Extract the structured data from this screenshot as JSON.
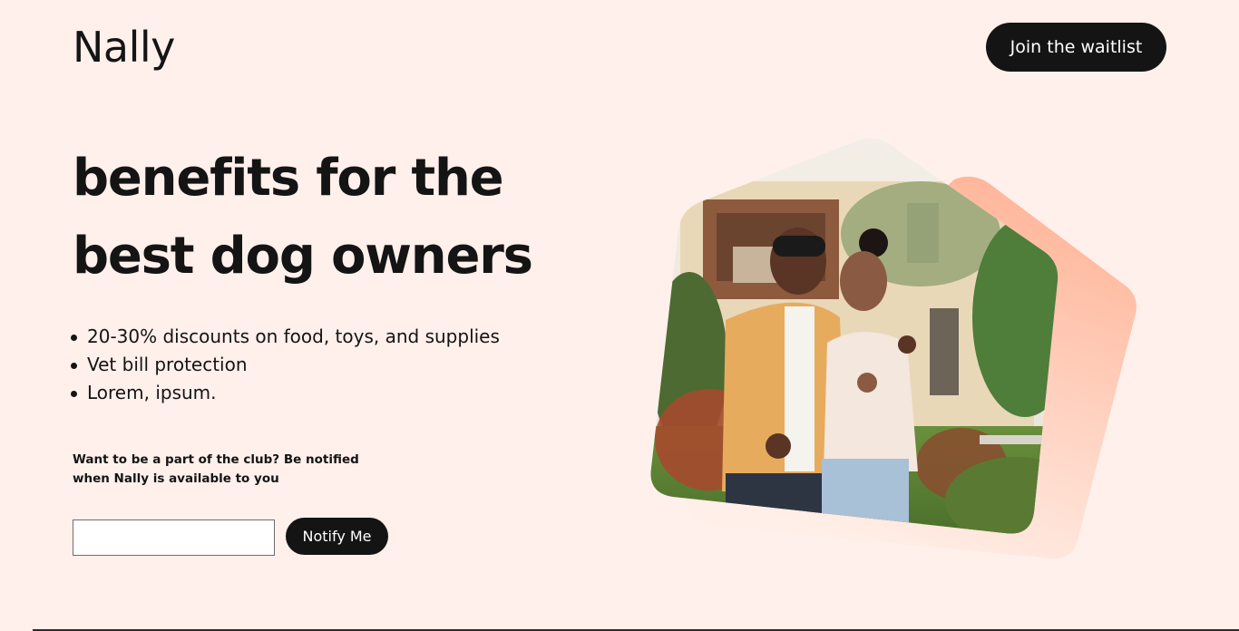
{
  "brand": {
    "name": "Nally"
  },
  "header": {
    "waitlist_button": "Join the waitlist"
  },
  "hero": {
    "headline_line1": "benefits for the",
    "headline_line2": "best dog owners",
    "benefits": [
      "20-30% discounts on food, toys, and supplies",
      "Vet bill protection",
      "Lorem, ipsum."
    ]
  },
  "signup": {
    "prompt": "Want to be a part of the club? Be notified when Nally is available to you",
    "email_value": "",
    "button_label": "Notify Me"
  },
  "colors": {
    "background": "#fff0eb",
    "text": "#141414",
    "button_bg": "#141414",
    "button_text": "#ffffff",
    "accent_peach": "#ffb79c"
  },
  "icons": {
    "hero_image": "couple-photo-in-house-shape"
  }
}
